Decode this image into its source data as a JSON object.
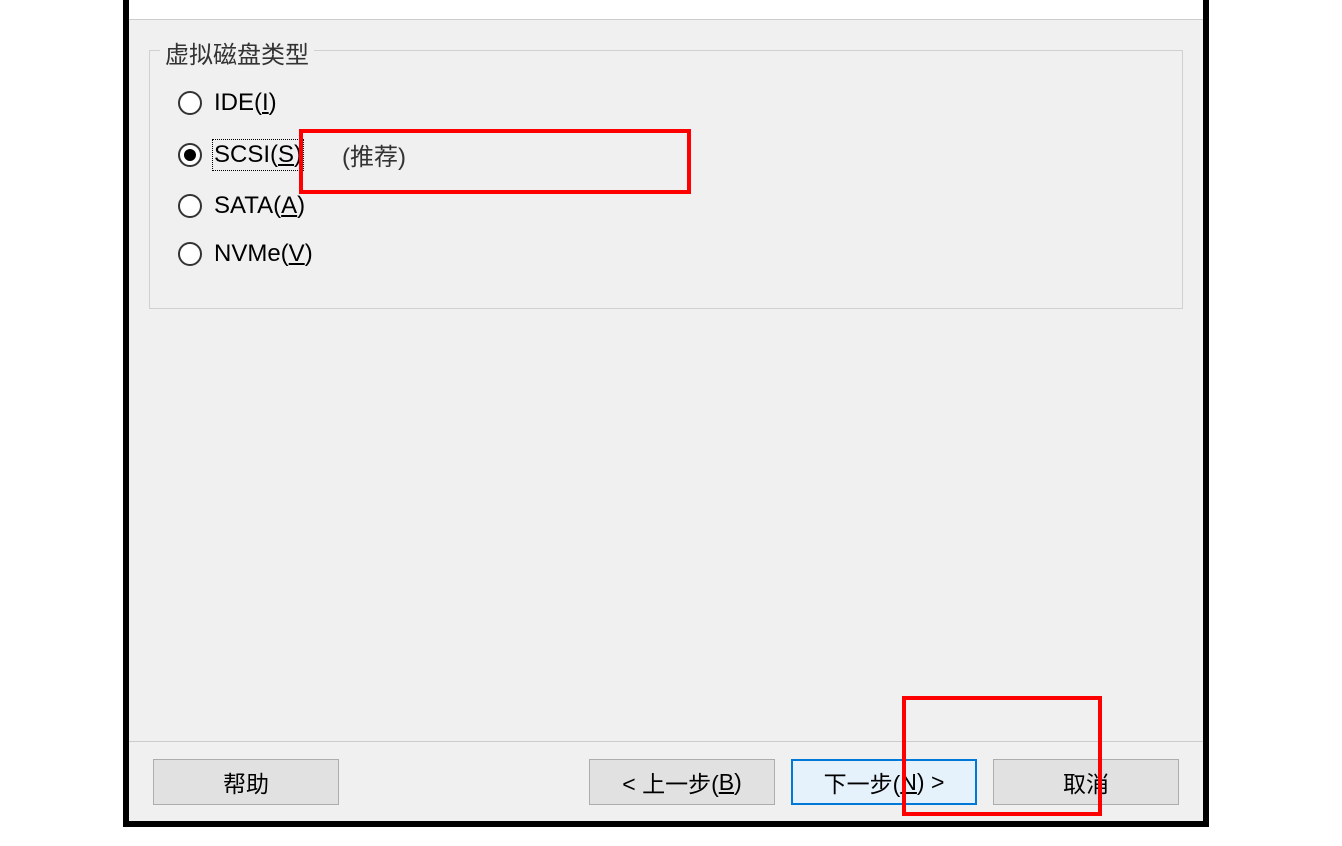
{
  "groupbox": {
    "title": "虚拟磁盘类型"
  },
  "options": {
    "ide": {
      "prefix": "IDE(",
      "accel": "I",
      "suffix": ")"
    },
    "scsi": {
      "prefix": "SCSI(",
      "accel": "S",
      "suffix": ")",
      "recommend": "(推荐)"
    },
    "sata": {
      "prefix": "SATA(",
      "accel": "A",
      "suffix": ")"
    },
    "nvme": {
      "prefix": "NVMe(",
      "accel": "V",
      "suffix": ")"
    }
  },
  "buttons": {
    "help": "帮助",
    "back": {
      "pre": "< 上一步(",
      "accel": "B",
      "post": ")"
    },
    "next": {
      "pre": "下一步(",
      "accel": "N",
      "post": ") >"
    },
    "cancel": "取消"
  }
}
